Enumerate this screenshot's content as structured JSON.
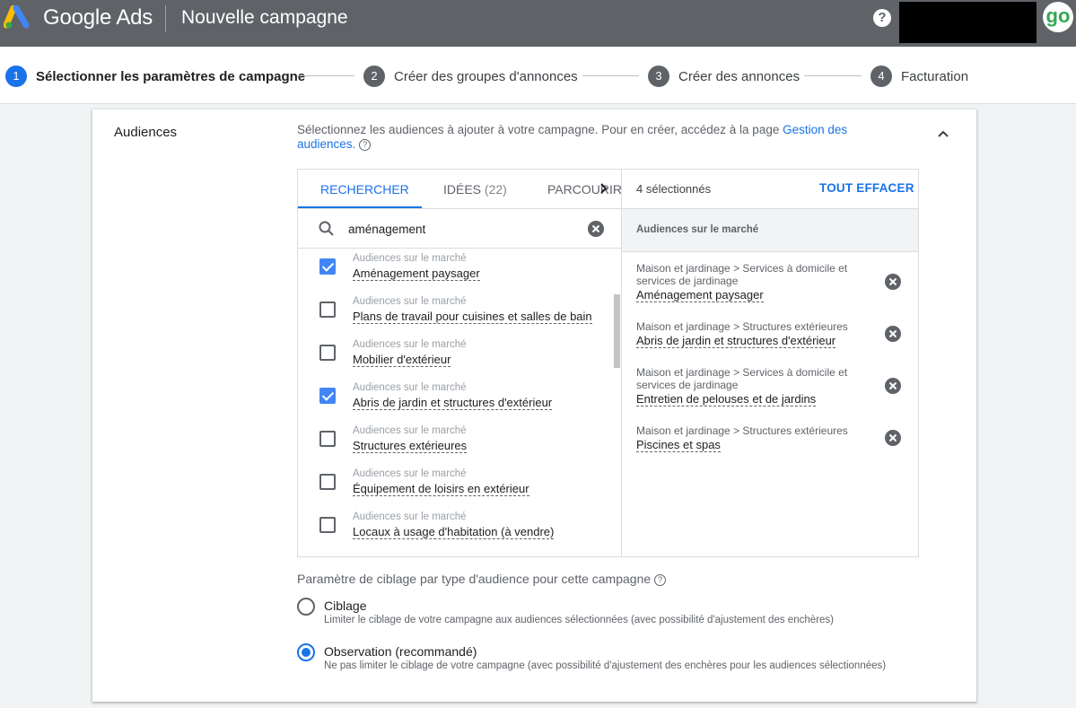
{
  "header": {
    "brand": "Google Ads",
    "title": "Nouvelle campagne",
    "help_icon": "help-circle-icon",
    "avatar_text": "go",
    "brand_colors": [
      "#fbbc04",
      "#4285f4",
      "#34a853"
    ]
  },
  "stepper": [
    {
      "num": "1",
      "label": "Sélectionner les paramètres de campagne",
      "active": true
    },
    {
      "num": "2",
      "label": "Créer des groupes d'annonces"
    },
    {
      "num": "3",
      "label": "Créer des annonces"
    },
    {
      "num": "4",
      "label": "Facturation"
    }
  ],
  "section": {
    "label": "Audiences",
    "desc_text": "Sélectionnez les audiences à ajouter à votre campagne. Pour en créer, accédez à la page ",
    "desc_link": "Gestion des audiences.",
    "help_mark": "?"
  },
  "tabs": {
    "search": "RECHERCHER",
    "ideas": "IDÉES",
    "ideas_count": "(22)",
    "browse": "PARCOURIR"
  },
  "search": {
    "value": "aménagement"
  },
  "results": [
    {
      "category": "Audiences sur le marché",
      "name": "Aménagement paysager",
      "checked": true
    },
    {
      "category": "Audiences sur le marché",
      "name": "Plans de travail pour cuisines et salles de bain",
      "checked": false
    },
    {
      "category": "Audiences sur le marché",
      "name": "Mobilier d'extérieur",
      "checked": false
    },
    {
      "category": "Audiences sur le marché",
      "name": "Abris de jardin et structures d'extérieur",
      "checked": true
    },
    {
      "category": "Audiences sur le marché",
      "name": "Structures extérieures",
      "checked": false
    },
    {
      "category": "Audiences sur le marché",
      "name": "Équipement de loisirs en extérieur",
      "checked": false
    },
    {
      "category": "Audiences sur le marché",
      "name": "Locaux à usage d'habitation (à vendre)",
      "checked": false
    }
  ],
  "selected": {
    "count_label": "4 sélectionnés",
    "clear_all": "TOUT EFFACER",
    "group_label": "Audiences sur le marché",
    "items": [
      {
        "path": "Maison et jardinage > Services à domicile et services de jardinage",
        "name": "Aménagement paysager"
      },
      {
        "path": "Maison et jardinage > Structures extérieures",
        "name": "Abris de jardin et structures d'extérieur"
      },
      {
        "path": "Maison et jardinage > Services à domicile et services de jardinage",
        "name": "Entretien de pelouses et de jardins"
      },
      {
        "path": "Maison et jardinage > Structures extérieures",
        "name": "Piscines et spas"
      }
    ]
  },
  "targeting": {
    "title": "Paramètre de ciblage par type d'audience pour cette campagne",
    "options": [
      {
        "label": "Ciblage",
        "desc": "Limiter le ciblage de votre campagne aux audiences sélectionnées (avec possibilité d'ajustement des enchères)",
        "selected": false
      },
      {
        "label": "Observation (recommandé)",
        "desc": "Ne pas limiter le ciblage de votre campagne (avec possibilité d'ajustement des enchères pour les audiences sélectionnées)",
        "selected": true
      }
    ]
  },
  "colors": {
    "accent": "#1a73e8",
    "topbar": "#5f6368",
    "checkbox": "#4285f4"
  }
}
